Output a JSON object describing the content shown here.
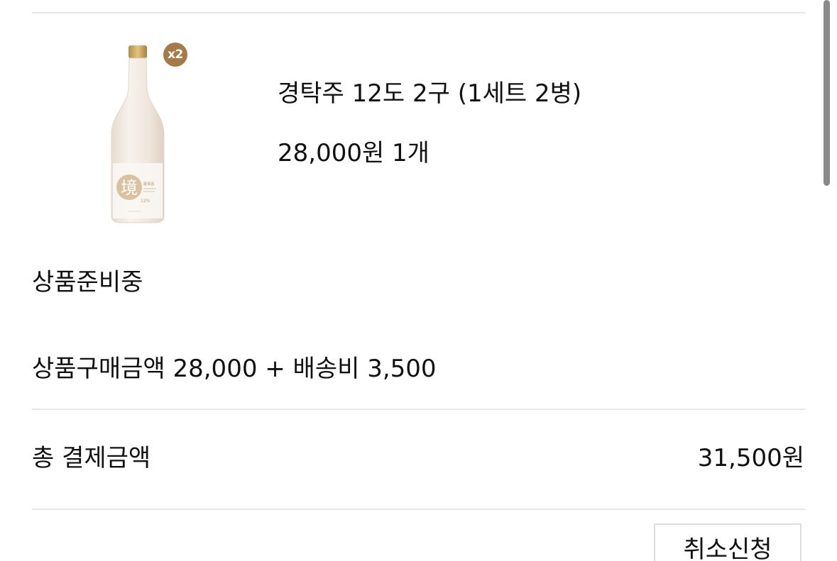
{
  "product": {
    "name": "경탁주 12도 2구 (1세트 2병)",
    "price_qty": "28,000원 1개",
    "badge": "x2",
    "image": {
      "icon": "makgeolli-bottle-image",
      "label_char": "境",
      "label_sub": "12%",
      "colors": {
        "bottle": "#f1ebe3",
        "cap": "#c9a35a",
        "label_accent": "#c7a57a"
      }
    }
  },
  "order": {
    "status": "상품준비중",
    "breakdown": "상품구매금액 28,000 + 배송비 3,500"
  },
  "total": {
    "label": "총 결제금액",
    "value": "31,500원"
  },
  "actions": {
    "cancel_label": "취소신청"
  },
  "colors": {
    "badge": "#a57a46",
    "divider": "#e6e6e6",
    "text": "#111111"
  }
}
